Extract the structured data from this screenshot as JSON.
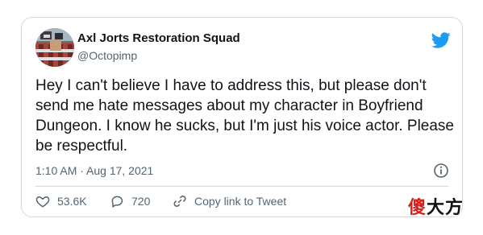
{
  "tweet": {
    "author_name": "Axl Jorts Restoration Squad",
    "author_handle": "@Octopimp",
    "text": "Hey I can't believe I have to address this, but please don't send me hate messages about my character in Boyfriend Dungeon. I know he sucks, but I'm just his voice actor. Please be respectful.",
    "timestamp": "1:10 AM · Aug 17, 2021",
    "likes": "53.6K",
    "replies": "720",
    "copy_link_label": "Copy link to Tweet"
  },
  "icons": {
    "brand": "twitter-bird-icon",
    "info": "info-icon",
    "like": "heart-icon",
    "reply": "reply-bubble-icon",
    "link": "link-icon"
  },
  "watermark": {
    "char1": "傻",
    "char2": "大方",
    "color1": "#d0201a",
    "color2": "#111111"
  },
  "colors": {
    "brand_blue": "#1d9bf0",
    "muted": "#536471",
    "text": "#0f1419",
    "border": "#cfd9de"
  }
}
